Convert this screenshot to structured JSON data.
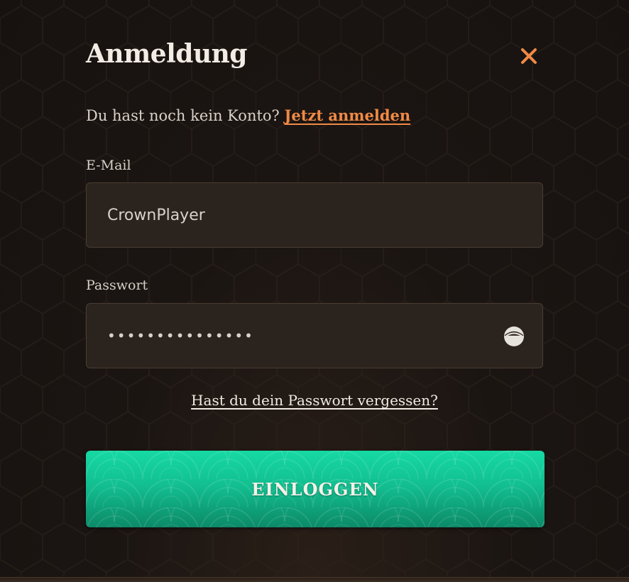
{
  "modal": {
    "title": "Anmeldung",
    "close_icon": "close-icon",
    "signup_prompt": "Du hast noch kein Konto?",
    "signup_link": "Jetzt anmelden"
  },
  "form": {
    "email_label": "E-Mail",
    "email_value": "CrownPlayer",
    "password_label": "Passwort",
    "password_value": "•••••••••••••••",
    "password_toggle_icon": "eye-icon",
    "forgot_link": "Hast du dein Passwort vergessen?",
    "submit_label": "EINLOGGEN"
  },
  "colors": {
    "accent": "#f08a45",
    "button": "#12bf90",
    "background": "#1b1512",
    "field": "#2b231e"
  }
}
